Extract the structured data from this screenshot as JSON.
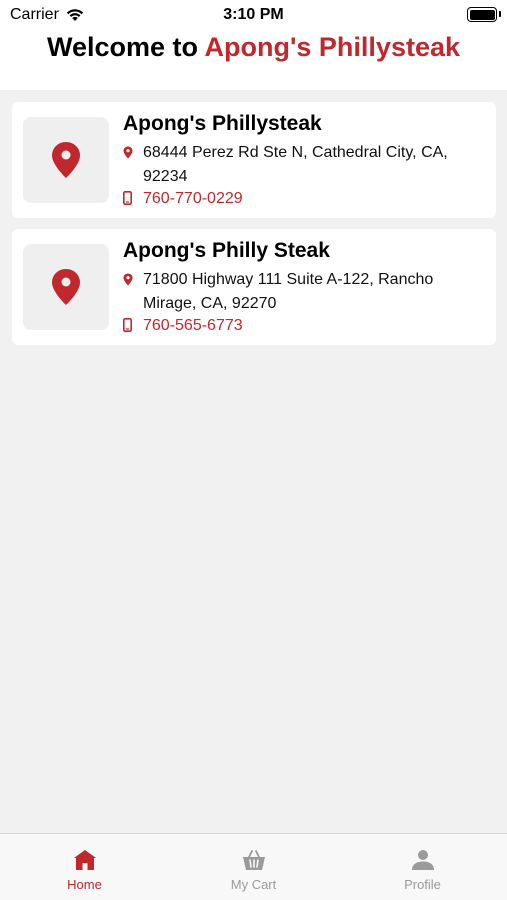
{
  "status_bar": {
    "carrier": "Carrier",
    "time": "3:10 PM"
  },
  "header": {
    "welcome_prefix": "Welcome to ",
    "brand_name": "Apong's Phillysteak"
  },
  "locations": [
    {
      "name": "Apong's Phillysteak",
      "address": "68444 Perez Rd Ste N, Cathedral City, CA, 92234",
      "phone": "760-770-0229"
    },
    {
      "name": "Apong's Philly Steak",
      "address": "71800 Highway 111 Suite A-122, Rancho Mirage, CA, 92270",
      "phone": "760-565-6773"
    }
  ],
  "tab_bar": {
    "tabs": [
      {
        "label": "Home",
        "icon": "home-icon",
        "active": true
      },
      {
        "label": "My Cart",
        "icon": "cart-icon",
        "active": false
      },
      {
        "label": "Profile",
        "icon": "profile-icon",
        "active": false
      }
    ]
  },
  "colors": {
    "accent": "#c0282d",
    "inactive": "#9a9a9a",
    "background": "#f1f1f1"
  }
}
